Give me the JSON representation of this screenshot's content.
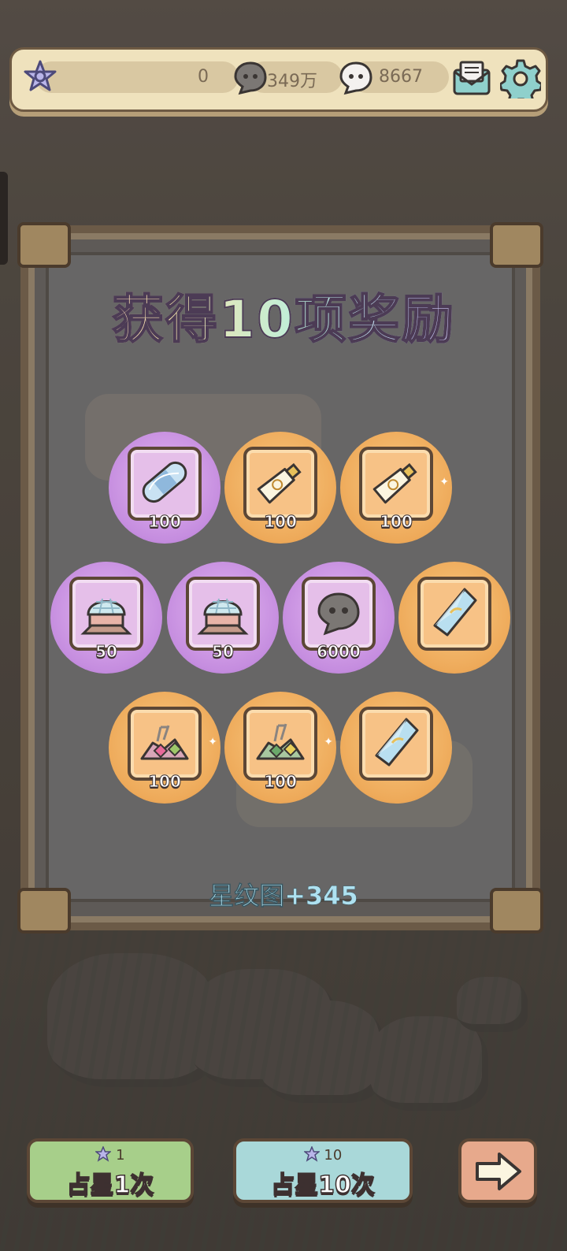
{
  "header": {
    "resources": [
      {
        "name": "star-badge",
        "value": "0"
      },
      {
        "name": "dark-ghost",
        "value": "349万"
      },
      {
        "name": "white-ghost",
        "value": "8667"
      }
    ],
    "icons": [
      "star-badge-icon",
      "dark-ghost-icon",
      "white-ghost-icon",
      "mail-icon",
      "gear-icon"
    ]
  },
  "popup": {
    "title": "获得10项奖励",
    "summary": "星纹图+345",
    "rewards": [
      {
        "icon": "bandage-icon",
        "count": "100",
        "bg": "purple"
      },
      {
        "icon": "tube-icon",
        "count": "100",
        "bg": "orange"
      },
      {
        "icon": "tube-icon",
        "count": "100",
        "bg": "orange"
      },
      {
        "icon": "crystal-dome-icon",
        "count": "50",
        "bg": "purple"
      },
      {
        "icon": "crystal-dome-icon",
        "count": "50",
        "bg": "purple"
      },
      {
        "icon": "dark-ghost-icon",
        "count": "6000",
        "bg": "purple"
      },
      {
        "icon": "crystal-shard-icon",
        "count": "",
        "bg": "orange"
      },
      {
        "icon": "pink-gem-pile-icon",
        "count": "100",
        "bg": "orange"
      },
      {
        "icon": "green-gem-pile-icon",
        "count": "100",
        "bg": "orange"
      },
      {
        "icon": "crystal-shard-icon",
        "count": "",
        "bg": "orange"
      }
    ]
  },
  "footer": {
    "draw_one": {
      "cost": "1",
      "label": "占星1次"
    },
    "draw_ten": {
      "cost": "10",
      "label": "占星10次"
    },
    "next_icon": "arrow-right-icon"
  },
  "colors": {
    "purple": "#c58ddf",
    "orange": "#eeaa5a",
    "frame": "#6b5a47",
    "topbar": "#efe2bd"
  }
}
